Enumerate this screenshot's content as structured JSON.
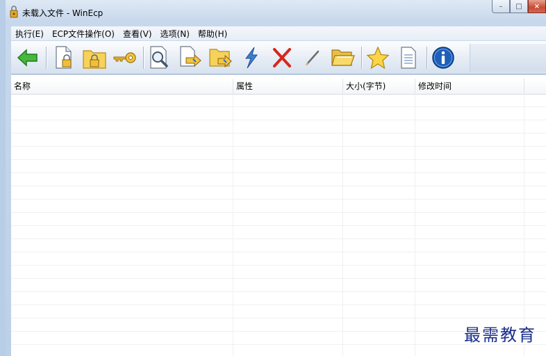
{
  "window": {
    "title": "未载入文件 - WinEcp",
    "controls": {
      "minimize": "–",
      "maximize": "□",
      "close": "×"
    }
  },
  "menu": [
    {
      "label": "执行(E)"
    },
    {
      "label": "ECP文件操作(O)"
    },
    {
      "label": "查看(V)"
    },
    {
      "label": "选项(N)"
    },
    {
      "label": "帮助(H)"
    }
  ],
  "toolbar": {
    "buttons": [
      {
        "icon": "back-arrow-icon"
      },
      {
        "icon": "encrypt-file-icon"
      },
      {
        "icon": "encrypt-folder-icon"
      },
      {
        "icon": "key-icon"
      },
      {
        "icon": "preview-icon"
      },
      {
        "icon": "extract-file-icon"
      },
      {
        "icon": "extract-folder-icon"
      },
      {
        "icon": "quick-run-icon"
      },
      {
        "icon": "delete-icon"
      },
      {
        "icon": "rename-icon"
      },
      {
        "icon": "open-folder-icon"
      },
      {
        "icon": "favorite-icon"
      },
      {
        "icon": "document-icon"
      },
      {
        "icon": "info-icon"
      }
    ]
  },
  "list": {
    "columns": [
      {
        "label": "名称"
      },
      {
        "label": "属性"
      },
      {
        "label": "大小(字节)"
      },
      {
        "label": "修改时间"
      }
    ],
    "rows": []
  },
  "watermark": "最需教育",
  "colors": {
    "accent_green": "#3aa83a",
    "folder_yellow": "#f3c64a",
    "delete_red": "#d6261c",
    "info_blue": "#1e5fb8"
  }
}
